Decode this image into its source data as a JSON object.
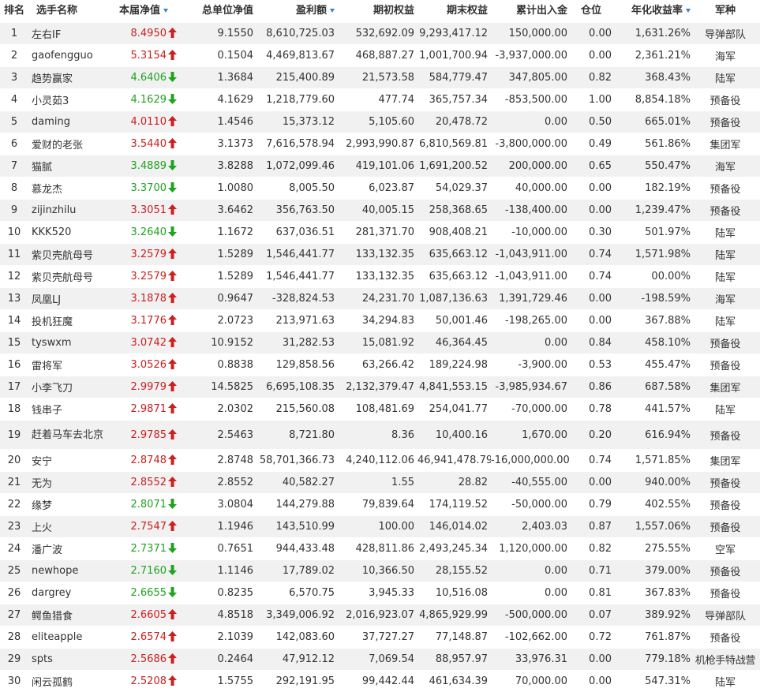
{
  "table": {
    "headers": {
      "rank": "排名",
      "name": "选手名称",
      "nav": "本届净值",
      "unit_nav": "总单位净值",
      "profit": "盈利额",
      "begin_equity": "期初权益",
      "end_equity": "期末权益",
      "cum_flow": "累计出入金",
      "position": "仓位",
      "annual_return": "年化收益率",
      "army": "军种"
    },
    "sorted_columns": [
      "nav",
      "profit",
      "annual_return"
    ],
    "colors": {
      "up": "#cc1f1f",
      "down": "#1fa31f",
      "sort_indicator": "#3b7fc4",
      "row_alt": "#f1f1f1"
    },
    "rows": [
      {
        "rank": "1",
        "name": "左右IF",
        "nav": "8.4950",
        "dir": "up",
        "unit_nav": "9.1550",
        "profit": "8,610,725.03",
        "begin_equity": "532,692.09",
        "end_equity": "9,293,417.12",
        "cum_flow": "150,000.00",
        "position": "0.00",
        "annual_return": "1,631.26%",
        "army": "导弹部队"
      },
      {
        "rank": "2",
        "name": "gaofengguo",
        "nav": "5.3154",
        "dir": "up",
        "unit_nav": "0.1504",
        "profit": "4,469,813.67",
        "begin_equity": "468,887.27",
        "end_equity": "1,001,700.94",
        "cum_flow": "-3,937,000.00",
        "position": "0.00",
        "annual_return": "2,361.21%",
        "army": "海军"
      },
      {
        "rank": "3",
        "name": "趋势赢家",
        "nav": "4.6406",
        "dir": "down",
        "unit_nav": "1.3684",
        "profit": "215,400.89",
        "begin_equity": "21,573.58",
        "end_equity": "584,779.47",
        "cum_flow": "347,805.00",
        "position": "0.82",
        "annual_return": "368.43%",
        "army": "陆军"
      },
      {
        "rank": "4",
        "name": "小灵茹3",
        "nav": "4.1629",
        "dir": "down",
        "unit_nav": "4.1629",
        "profit": "1,218,779.60",
        "begin_equity": "477.74",
        "end_equity": "365,757.34",
        "cum_flow": "-853,500.00",
        "position": "1.00",
        "annual_return": "8,854.18%",
        "army": "预备役"
      },
      {
        "rank": "5",
        "name": "daming",
        "nav": "4.0110",
        "dir": "up",
        "unit_nav": "1.4546",
        "profit": "15,373.12",
        "begin_equity": "5,105.60",
        "end_equity": "20,478.72",
        "cum_flow": "0.00",
        "position": "0.50",
        "annual_return": "665.01%",
        "army": "预备役"
      },
      {
        "rank": "6",
        "name": "爱财的老张",
        "nav": "3.5440",
        "dir": "up",
        "unit_nav": "3.1373",
        "profit": "7,616,578.94",
        "begin_equity": "2,993,990.87",
        "end_equity": "6,810,569.81",
        "cum_flow": "-3,800,000.00",
        "position": "0.49",
        "annual_return": "561.86%",
        "army": "集团军"
      },
      {
        "rank": "7",
        "name": "猫腻",
        "nav": "3.4889",
        "dir": "down",
        "unit_nav": "3.8288",
        "profit": "1,072,099.46",
        "begin_equity": "419,101.06",
        "end_equity": "1,691,200.52",
        "cum_flow": "200,000.00",
        "position": "0.65",
        "annual_return": "550.47%",
        "army": "海军"
      },
      {
        "rank": "8",
        "name": "慕龙杰",
        "nav": "3.3700",
        "dir": "down",
        "unit_nav": "1.0080",
        "profit": "8,005.50",
        "begin_equity": "6,023.87",
        "end_equity": "54,029.37",
        "cum_flow": "40,000.00",
        "position": "0.00",
        "annual_return": "182.19%",
        "army": "预备役"
      },
      {
        "rank": "9",
        "name": "zijinzhilu",
        "nav": "3.3051",
        "dir": "up",
        "unit_nav": "3.6462",
        "profit": "356,763.50",
        "begin_equity": "40,005.15",
        "end_equity": "258,368.65",
        "cum_flow": "-138,400.00",
        "position": "0.00",
        "annual_return": "1,239.47%",
        "army": "预备役"
      },
      {
        "rank": "10",
        "name": "KKK520",
        "nav": "3.2640",
        "dir": "down",
        "unit_nav": "1.1672",
        "profit": "637,036.51",
        "begin_equity": "281,371.70",
        "end_equity": "908,408.21",
        "cum_flow": "-10,000.00",
        "position": "0.30",
        "annual_return": "501.97%",
        "army": "陆军"
      },
      {
        "rank": "11",
        "name": "紫贝壳航母号",
        "nav": "3.2579",
        "dir": "up",
        "unit_nav": "1.5289",
        "profit": "1,546,441.77",
        "begin_equity": "133,132.35",
        "end_equity": "635,663.12",
        "cum_flow": "-1,043,911.00",
        "position": "0.74",
        "annual_return": "1,571.98%",
        "army": "陆军"
      },
      {
        "rank": "12",
        "name": "紫贝壳航母号",
        "nav": "3.2579",
        "dir": "up",
        "unit_nav": "1.5289",
        "profit": "1,546,441.77",
        "begin_equity": "133,132.35",
        "end_equity": "635,663.12",
        "cum_flow": "-1,043,911.00",
        "position": "0.74",
        "annual_return": "00.00%",
        "army": "陆军"
      },
      {
        "rank": "13",
        "name": "凤凰LJ",
        "nav": "3.1878",
        "dir": "up",
        "unit_nav": "0.9647",
        "profit": "-328,824.53",
        "begin_equity": "24,231.70",
        "end_equity": "1,087,136.63",
        "cum_flow": "1,391,729.46",
        "position": "0.00",
        "annual_return": "-198.59%",
        "army": "海军"
      },
      {
        "rank": "14",
        "name": "投机狂魔",
        "nav": "3.1776",
        "dir": "up",
        "unit_nav": "2.0723",
        "profit": "213,971.63",
        "begin_equity": "34,294.83",
        "end_equity": "50,001.46",
        "cum_flow": "-198,265.00",
        "position": "0.00",
        "annual_return": "367.88%",
        "army": "陆军"
      },
      {
        "rank": "15",
        "name": "tyswxm",
        "nav": "3.0742",
        "dir": "up",
        "unit_nav": "10.9152",
        "profit": "31,282.53",
        "begin_equity": "15,081.92",
        "end_equity": "46,364.45",
        "cum_flow": "0.00",
        "position": "0.84",
        "annual_return": "458.10%",
        "army": "预备役"
      },
      {
        "rank": "16",
        "name": "雷将军",
        "nav": "3.0526",
        "dir": "up",
        "unit_nav": "0.8838",
        "profit": "129,858.56",
        "begin_equity": "63,266.42",
        "end_equity": "189,224.98",
        "cum_flow": "-3,900.00",
        "position": "0.53",
        "annual_return": "455.47%",
        "army": "预备役"
      },
      {
        "rank": "17",
        "name": "小李飞刀",
        "nav": "2.9979",
        "dir": "up",
        "unit_nav": "14.5825",
        "profit": "6,695,108.35",
        "begin_equity": "2,132,379.47",
        "end_equity": "4,841,553.15",
        "cum_flow": "-3,985,934.67",
        "position": "0.86",
        "annual_return": "687.58%",
        "army": "集团军"
      },
      {
        "rank": "18",
        "name": "钱串子",
        "nav": "2.9871",
        "dir": "up",
        "unit_nav": "2.0302",
        "profit": "215,560.08",
        "begin_equity": "108,481.69",
        "end_equity": "254,041.77",
        "cum_flow": "-70,000.00",
        "position": "0.78",
        "annual_return": "441.57%",
        "army": "陆军"
      },
      {
        "rank": "19",
        "name": "赶着马车去北京",
        "nav": "2.9785",
        "dir": "up",
        "unit_nav": "2.5463",
        "profit": "8,721.80",
        "begin_equity": "8.36",
        "end_equity": "10,400.16",
        "cum_flow": "1,670.00",
        "position": "0.20",
        "annual_return": "616.94%",
        "army": "预备役",
        "tall": true
      },
      {
        "rank": "20",
        "name": "安宁",
        "nav": "2.8748",
        "dir": "up",
        "unit_nav": "2.8748",
        "profit": "58,701,366.73",
        "begin_equity": "4,240,112.06",
        "end_equity": "46,941,478.79",
        "cum_flow": "-16,000,000.00",
        "position": "0.74",
        "annual_return": "1,571.85%",
        "army": "集团军"
      },
      {
        "rank": "21",
        "name": "无为",
        "nav": "2.8552",
        "dir": "up",
        "unit_nav": "2.8552",
        "profit": "40,582.27",
        "begin_equity": "1.55",
        "end_equity": "28.82",
        "cum_flow": "-40,555.00",
        "position": "0.00",
        "annual_return": "940.00%",
        "army": "预备役"
      },
      {
        "rank": "22",
        "name": "缘梦",
        "nav": "2.8071",
        "dir": "down",
        "unit_nav": "3.0804",
        "profit": "144,279.88",
        "begin_equity": "79,839.64",
        "end_equity": "174,119.52",
        "cum_flow": "-50,000.00",
        "position": "0.79",
        "annual_return": "402.55%",
        "army": "预备役"
      },
      {
        "rank": "23",
        "name": "上火",
        "nav": "2.7547",
        "dir": "up",
        "unit_nav": "1.1946",
        "profit": "143,510.99",
        "begin_equity": "100.00",
        "end_equity": "146,014.02",
        "cum_flow": "2,403.03",
        "position": "0.87",
        "annual_return": "1,557.06%",
        "army": "预备役"
      },
      {
        "rank": "24",
        "name": "潘广波",
        "nav": "2.7371",
        "dir": "down",
        "unit_nav": "0.7651",
        "profit": "944,433.48",
        "begin_equity": "428,811.86",
        "end_equity": "2,493,245.34",
        "cum_flow": "1,120,000.00",
        "position": "0.82",
        "annual_return": "275.55%",
        "army": "空军"
      },
      {
        "rank": "25",
        "name": "newhope",
        "nav": "2.7160",
        "dir": "down",
        "unit_nav": "1.1146",
        "profit": "17,789.02",
        "begin_equity": "10,366.50",
        "end_equity": "28,155.52",
        "cum_flow": "0.00",
        "position": "0.71",
        "annual_return": "379.00%",
        "army": "预备役"
      },
      {
        "rank": "26",
        "name": "dargrey",
        "nav": "2.6655",
        "dir": "down",
        "unit_nav": "0.8235",
        "profit": "6,570.75",
        "begin_equity": "3,945.33",
        "end_equity": "10,516.08",
        "cum_flow": "0.00",
        "position": "0.81",
        "annual_return": "367.83%",
        "army": "预备役"
      },
      {
        "rank": "27",
        "name": "鳄鱼猎食",
        "nav": "2.6605",
        "dir": "up",
        "unit_nav": "4.8518",
        "profit": "3,349,006.92",
        "begin_equity": "2,016,923.07",
        "end_equity": "4,865,929.99",
        "cum_flow": "-500,000.00",
        "position": "0.07",
        "annual_return": "389.92%",
        "army": "导弹部队"
      },
      {
        "rank": "28",
        "name": "eliteapple",
        "nav": "2.6574",
        "dir": "up",
        "unit_nav": "2.1039",
        "profit": "142,083.60",
        "begin_equity": "37,727.27",
        "end_equity": "77,148.87",
        "cum_flow": "-102,662.00",
        "position": "0.72",
        "annual_return": "761.87%",
        "army": "预备役"
      },
      {
        "rank": "29",
        "name": "spts",
        "nav": "2.5686",
        "dir": "up",
        "unit_nav": "0.2464",
        "profit": "47,912.12",
        "begin_equity": "7,069.54",
        "end_equity": "88,957.97",
        "cum_flow": "33,976.31",
        "position": "0.00",
        "annual_return": "779.18%",
        "army": "机枪手特战营"
      },
      {
        "rank": "30",
        "name": "闲云孤鹤",
        "nav": "2.5208",
        "dir": "up",
        "unit_nav": "1.5755",
        "profit": "292,191.95",
        "begin_equity": "99,442.44",
        "end_equity": "461,634.39",
        "cum_flow": "70,000.00",
        "position": "0.00",
        "annual_return": "547.31%",
        "army": "陆军"
      }
    ]
  }
}
